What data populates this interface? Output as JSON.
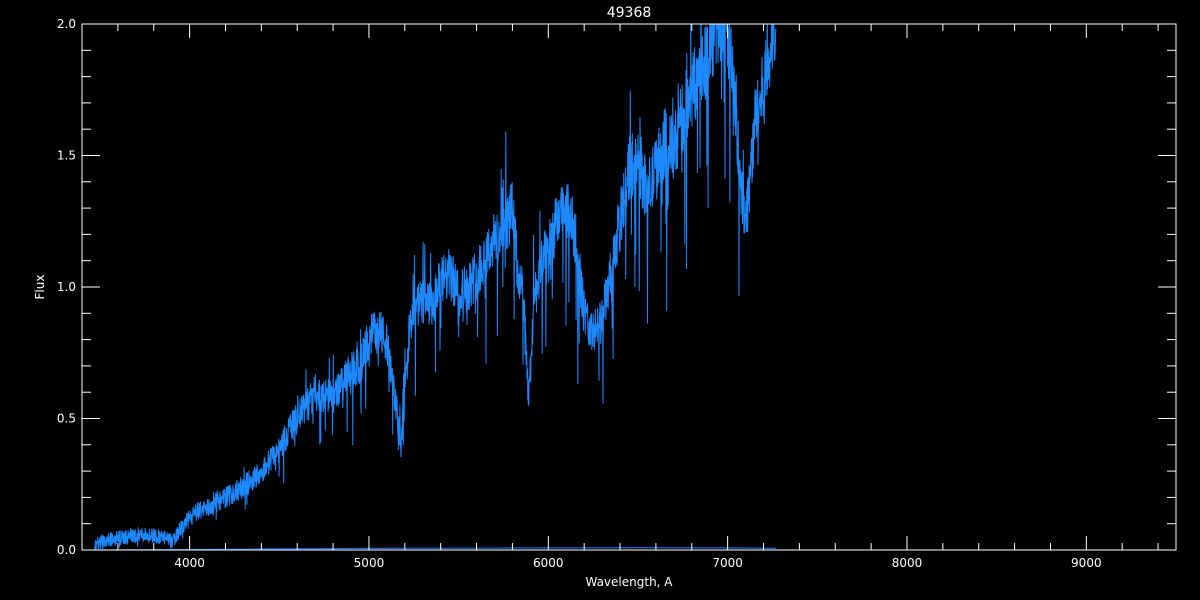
{
  "chart_data": {
    "type": "line",
    "title": "49368",
    "xlabel": "Wavelength, A",
    "ylabel": "Flux",
    "xlim": [
      3400,
      9500
    ],
    "ylim": [
      0.0,
      2.0
    ],
    "x_ticks": [
      4000,
      5000,
      6000,
      7000,
      8000,
      9000
    ],
    "y_ticks": [
      0.0,
      0.5,
      1.0,
      1.5,
      2.0
    ],
    "x_tick_labels": [
      "4000",
      "5000",
      "6000",
      "7000",
      "8000",
      "9000"
    ],
    "y_tick_labels": [
      "0.0",
      "0.5",
      "1.0",
      "1.5",
      "2.0"
    ],
    "grid": false,
    "colors": {
      "background": "#000000",
      "axes": "#ffffff",
      "spectrum": "#1e88ff",
      "error": "#1565d8"
    },
    "series": [
      {
        "x": [
          3470,
          3550,
          3650,
          3750,
          3850,
          3900,
          3950,
          4000,
          4050,
          4100,
          4200,
          4300,
          4400,
          4500,
          4550,
          4600,
          4650,
          4700,
          4800,
          4900,
          4950,
          5000,
          5050,
          5100,
          5150,
          5180,
          5200,
          5250,
          5300,
          5350,
          5400,
          5450,
          5500,
          5550,
          5600,
          5650,
          5700,
          5750,
          5800,
          5830,
          5860,
          5890,
          5920,
          5950,
          6000,
          6050,
          6100,
          6150,
          6200,
          6250,
          6300,
          6350,
          6400,
          6450,
          6500,
          6550,
          6600,
          6650,
          6700,
          6750,
          6800,
          6850,
          6900,
          6950,
          7000,
          7050,
          7080,
          7100,
          7130,
          7150,
          7200,
          7250,
          7270
        ],
        "values": [
          0.02,
          0.04,
          0.05,
          0.06,
          0.05,
          0.03,
          0.08,
          0.12,
          0.15,
          0.16,
          0.2,
          0.24,
          0.3,
          0.38,
          0.45,
          0.5,
          0.55,
          0.6,
          0.58,
          0.68,
          0.7,
          0.8,
          0.86,
          0.78,
          0.55,
          0.4,
          0.72,
          0.9,
          0.95,
          0.92,
          1.02,
          1.05,
          0.98,
          1.0,
          1.05,
          1.12,
          1.18,
          1.2,
          1.3,
          1.05,
          0.98,
          0.55,
          0.95,
          1.05,
          1.15,
          1.25,
          1.3,
          1.2,
          0.9,
          0.82,
          0.88,
          1.05,
          1.25,
          1.45,
          1.5,
          1.35,
          1.45,
          1.55,
          1.52,
          1.65,
          1.75,
          1.82,
          1.92,
          2.0,
          2.0,
          1.6,
          1.35,
          1.25,
          1.45,
          1.62,
          1.75,
          1.95,
          2.0
        ]
      },
      {
        "x": [
          3470,
          4000,
          4500,
          5000,
          5500,
          6000,
          6500,
          7000,
          7270
        ],
        "values": [
          0.0,
          0.002,
          0.004,
          0.006,
          0.007,
          0.008,
          0.009,
          0.008,
          0.006
        ]
      }
    ]
  }
}
